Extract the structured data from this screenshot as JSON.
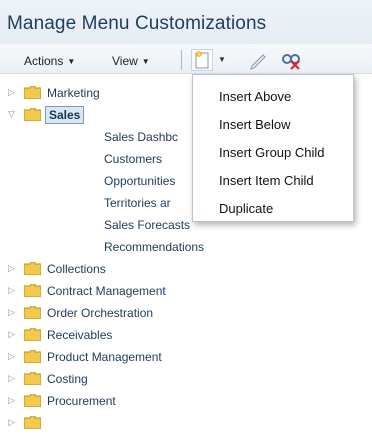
{
  "header": {
    "title": "Manage Menu Customizations"
  },
  "toolbar": {
    "actions_label": "Actions",
    "view_label": "View",
    "icons": [
      "new-item-icon",
      "chevron-down-icon",
      "pencil-icon",
      "detach-icon"
    ]
  },
  "tree": {
    "items": [
      {
        "label": "Marketing",
        "expanded": false
      },
      {
        "label": "Sales",
        "expanded": true,
        "selected": true
      },
      {
        "label": "Sales Dashbc"
      },
      {
        "label": "Customers"
      },
      {
        "label": "Opportunities"
      },
      {
        "label": "Territories ar"
      },
      {
        "label": "Sales Forecasts"
      },
      {
        "label": "Recommendations"
      },
      {
        "label": "Collections",
        "expanded": false
      },
      {
        "label": "Contract Management",
        "expanded": false
      },
      {
        "label": "Order Orchestration",
        "expanded": false
      },
      {
        "label": "Receivables",
        "expanded": false
      },
      {
        "label": "Product Management",
        "expanded": false
      },
      {
        "label": "Costing",
        "expanded": false
      },
      {
        "label": "Procurement",
        "expanded": false
      }
    ]
  },
  "popup_menu": {
    "items": [
      "Insert Above",
      "Insert Below",
      "Insert Group Child",
      "Insert Item Child",
      "Duplicate"
    ]
  },
  "colors": {
    "title": "#1d3e5c",
    "tree_text": "#1f3a57",
    "folder": "#f2c94c",
    "selection_bg": "#d9e7f5"
  }
}
